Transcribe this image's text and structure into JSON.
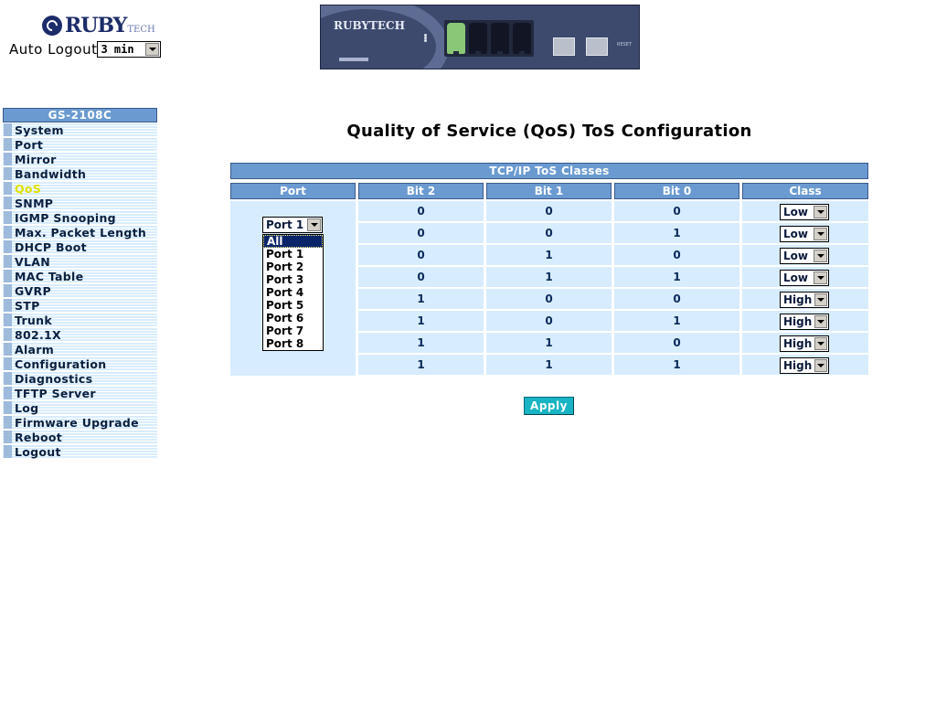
{
  "header": {
    "logo_text": "RUBY",
    "logo_sub": "TECH",
    "auto_logout_label": "Auto Logout",
    "auto_logout_value": "3 min"
  },
  "device": {
    "logo_text": "RUBYTECH",
    "reset_label": "RESET"
  },
  "sidebar": {
    "title": "GS-2108C",
    "active": "QoS",
    "items": [
      {
        "label": "System"
      },
      {
        "label": "Port"
      },
      {
        "label": "Mirror"
      },
      {
        "label": "Bandwidth"
      },
      {
        "label": "QoS"
      },
      {
        "label": "SNMP"
      },
      {
        "label": "IGMP Snooping"
      },
      {
        "label": "Max. Packet Length"
      },
      {
        "label": "DHCP Boot"
      },
      {
        "label": "VLAN"
      },
      {
        "label": "MAC Table"
      },
      {
        "label": "GVRP"
      },
      {
        "label": "STP"
      },
      {
        "label": "Trunk"
      },
      {
        "label": "802.1X"
      },
      {
        "label": "Alarm"
      },
      {
        "label": "Configuration"
      },
      {
        "label": "Diagnostics"
      },
      {
        "label": "TFTP Server"
      },
      {
        "label": "Log"
      },
      {
        "label": "Firmware Upgrade"
      },
      {
        "label": "Reboot"
      },
      {
        "label": "Logout"
      }
    ]
  },
  "main": {
    "title": "Quality of Service (QoS) ToS Configuration",
    "table_title": "TCP/IP ToS Classes",
    "columns": [
      "Port",
      "Bit 2",
      "Bit 1",
      "Bit 0",
      "Class"
    ],
    "port_value": "Port 1",
    "port_options": [
      "All",
      "Port 1",
      "Port 2",
      "Port 3",
      "Port 4",
      "Port 5",
      "Port 6",
      "Port 7",
      "Port 8"
    ],
    "port_highlighted": "All",
    "rows": [
      {
        "bit2": "0",
        "bit1": "0",
        "bit0": "0",
        "class": "Low"
      },
      {
        "bit2": "0",
        "bit1": "0",
        "bit0": "1",
        "class": "Low"
      },
      {
        "bit2": "0",
        "bit1": "1",
        "bit0": "0",
        "class": "Low"
      },
      {
        "bit2": "0",
        "bit1": "1",
        "bit0": "1",
        "class": "Low"
      },
      {
        "bit2": "1",
        "bit1": "0",
        "bit0": "0",
        "class": "High"
      },
      {
        "bit2": "1",
        "bit1": "0",
        "bit0": "1",
        "class": "High"
      },
      {
        "bit2": "1",
        "bit1": "1",
        "bit0": "0",
        "class": "High"
      },
      {
        "bit2": "1",
        "bit1": "1",
        "bit0": "1",
        "class": "High"
      }
    ],
    "apply_label": "Apply"
  },
  "colors": {
    "header_blue": "#6a9ad0",
    "cell_bg": "#d8ecff",
    "active_item": "#e0e000",
    "apply_button": "#18b4c4",
    "list_highlight": "#0a246a"
  },
  "icons": [
    "ruby-logo-icon",
    "dropdown-arrow-icon",
    "port-led-icon",
    "rj45-port-icon",
    "sfp-port-icon"
  ]
}
